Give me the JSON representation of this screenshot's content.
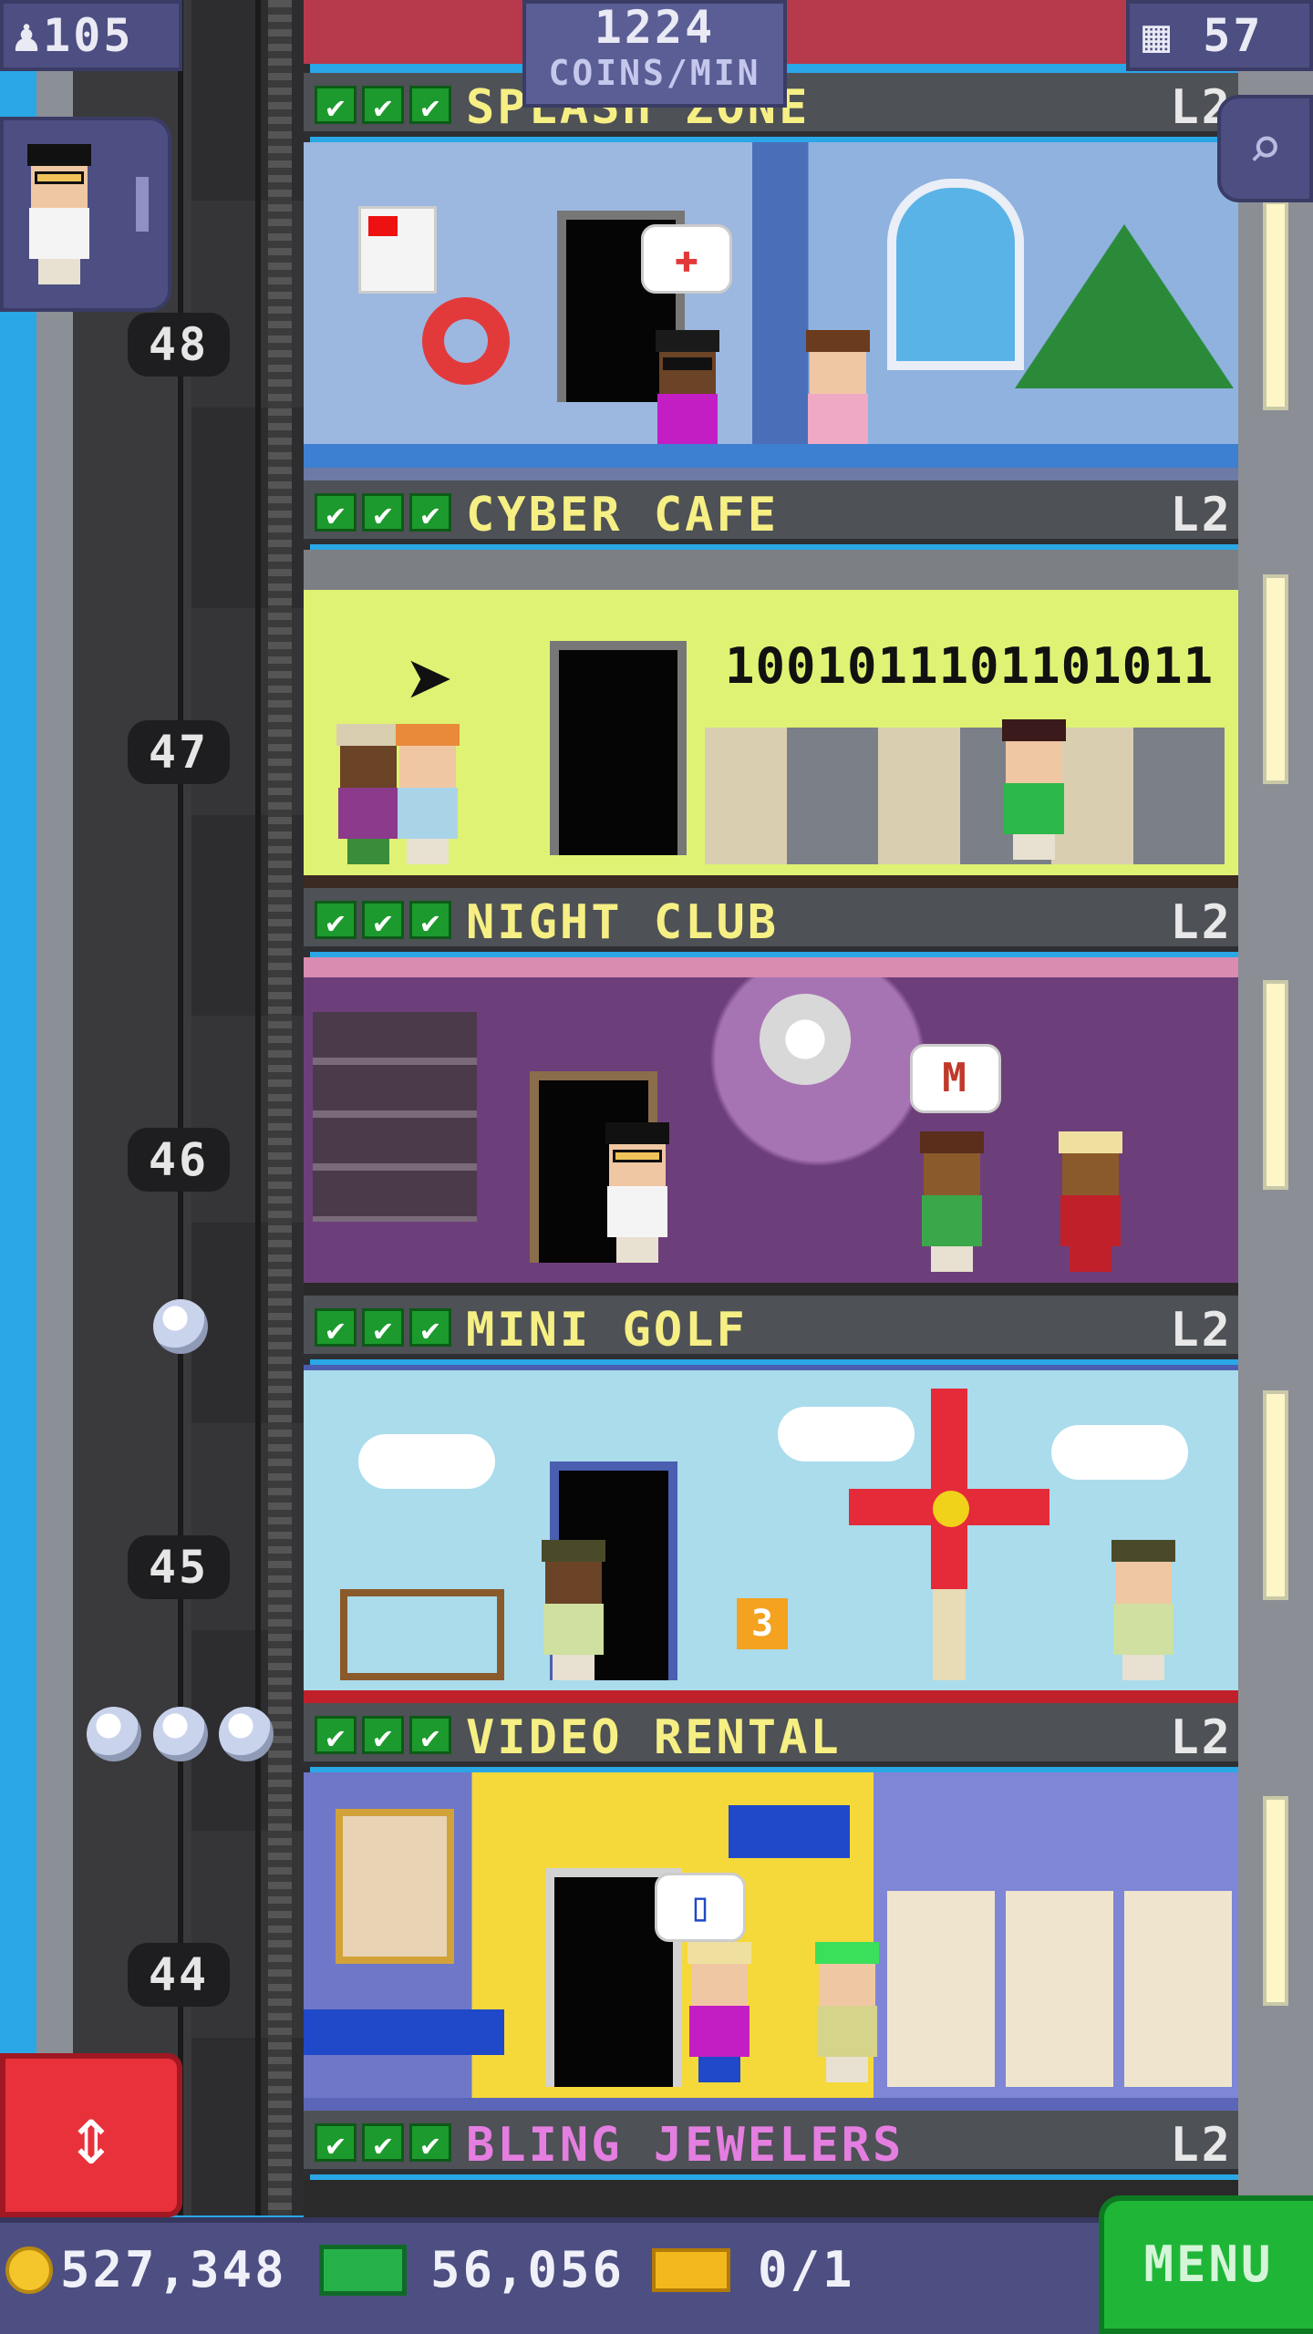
{
  "hud": {
    "population": "105",
    "coins_per_min_value": "1224",
    "coins_per_min_label": "COINS/MIN",
    "floor_count": "57"
  },
  "floors": [
    {
      "name": "SPLASH ZONE",
      "level": "L2",
      "number": "48"
    },
    {
      "name": "CYBER CAFE",
      "level": "L2",
      "number": "47",
      "binary_text": "1001011101101011"
    },
    {
      "name": "NIGHT CLUB",
      "level": "L2",
      "number": "46",
      "bubble_icon": "M"
    },
    {
      "name": "MINI GOLF",
      "level": "L2",
      "number": "45",
      "hole_number": "3"
    },
    {
      "name": "VIDEO RENTAL",
      "level": "L2",
      "number": "44"
    },
    {
      "name": "BLING JEWELERS",
      "level": "L2"
    }
  ],
  "checkmark": "✔",
  "bottom_bar": {
    "coins": "527,348",
    "bux": "56,056",
    "tickets": "0/1",
    "menu_label": "MENU"
  },
  "colors": {
    "hud_bg": "#4d4f82",
    "check_green": "#1d9a2e",
    "floor_name_yellow": "#f6ef84",
    "bling_pink": "#e47ee0",
    "menu_green": "#1fb637",
    "elevator_red": "#e8313b"
  }
}
